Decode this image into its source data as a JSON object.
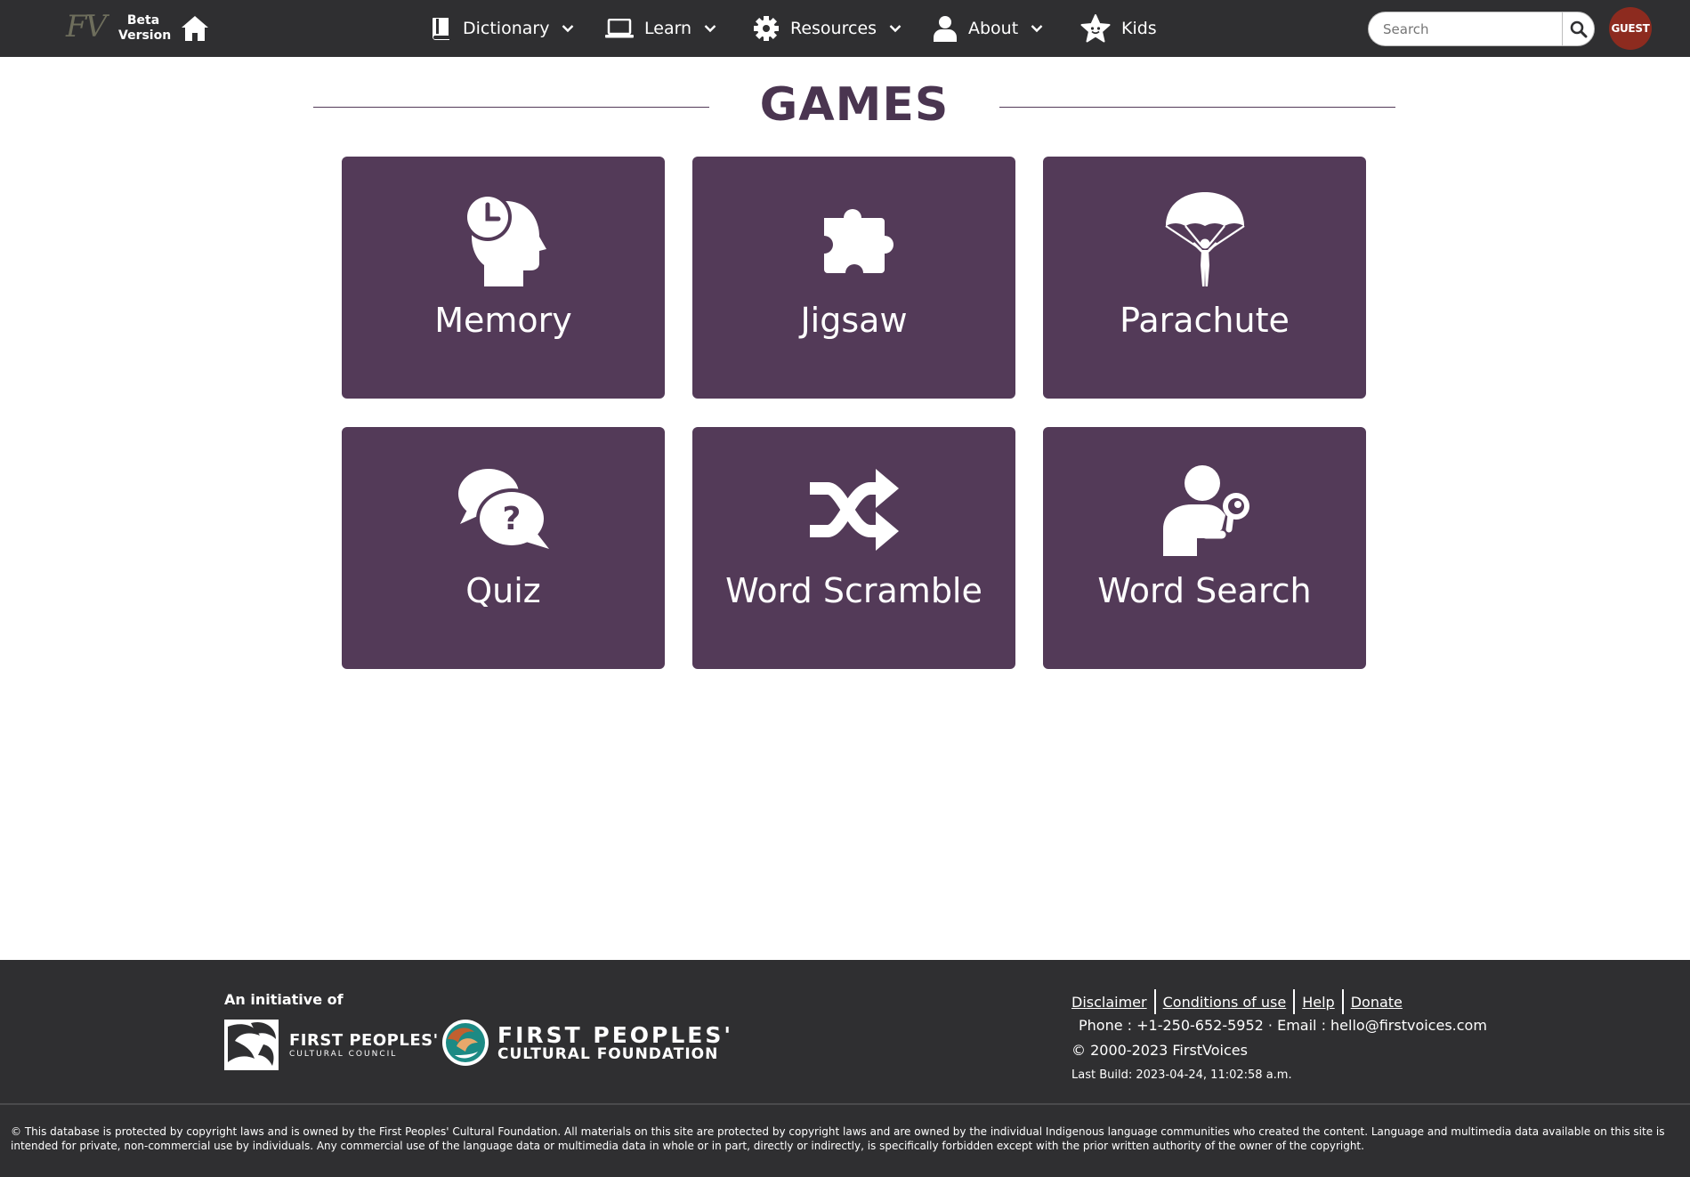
{
  "header": {
    "logo": "FV",
    "beta_label": "Beta Version",
    "nav": [
      {
        "label": "Dictionary",
        "icon": "book-icon"
      },
      {
        "label": "Learn",
        "icon": "laptop-icon"
      },
      {
        "label": "Resources",
        "icon": "gear-icon"
      },
      {
        "label": "About",
        "icon": "user-icon"
      },
      {
        "label": "Kids",
        "icon": "star-face-icon"
      }
    ],
    "search_placeholder": "Search",
    "user_label": "GUEST"
  },
  "main": {
    "title": "GAMES",
    "games": [
      {
        "label": "Memory",
        "icon": "head-clock-icon"
      },
      {
        "label": "Jigsaw",
        "icon": "puzzle-piece-icon"
      },
      {
        "label": "Parachute",
        "icon": "parachute-icon"
      },
      {
        "label": "Quiz",
        "icon": "question-bubbles-icon"
      },
      {
        "label": "Word Scramble",
        "icon": "shuffle-icon"
      },
      {
        "label": "Word Search",
        "icon": "person-magnifier-icon"
      }
    ]
  },
  "footer": {
    "initiative_label": "An initiative of",
    "fpcc_name": "FIRST PEOPLES'",
    "fpcc_sub": "CULTURAL COUNCIL",
    "fpcf_name": "FIRST PEOPLES'",
    "fpcf_sub": "CULTURAL FOUNDATION",
    "links": [
      "Disclaimer",
      "Conditions of use",
      "Help",
      "Donate"
    ],
    "contact": "Phone : +1-250-652-5952 · Email : hello@firstvoices.com",
    "copyright": "© 2000-2023 FirstVoices",
    "build": "Last Build: 2023-04-24, 11:02:58 a.m.",
    "legal": "© This database is protected by copyright laws and is owned by the First Peoples' Cultural Foundation. All materials on this site are protected by copyright laws and are owned by the individual Indigenous language communities who created the content. Language and multimedia data available on this site is intended for private, non-commercial use by individuals. Any commercial use of the language data or multimedia data in whole or in part, directly or indirectly, is specifically forbidden except with the prior written authority of the owner of the copyright."
  },
  "colors": {
    "topbar": "#2f2f31",
    "tile": "#533a58",
    "title": "#4a3550",
    "guest_badge": "#8d2b1f"
  }
}
